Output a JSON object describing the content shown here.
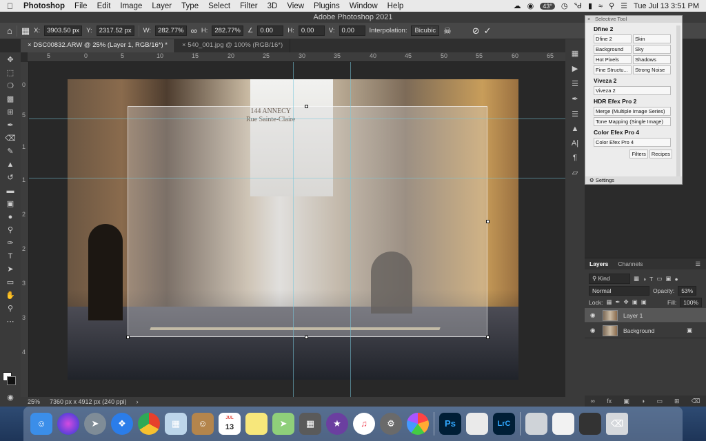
{
  "menubar": {
    "app_name": "Photoshop",
    "items": [
      "File",
      "Edit",
      "Image",
      "Layer",
      "Type",
      "Select",
      "Filter",
      "3D",
      "View",
      "Plugins",
      "Window",
      "Help"
    ],
    "temperature": "43°",
    "datetime": "Tue Jul 13  3:51 PM"
  },
  "window": {
    "title": "Adobe Photoshop 2021"
  },
  "options_bar": {
    "x_label": "X:",
    "x_value": "3903.50 px",
    "y_label": "Y:",
    "y_value": "2317.52 px",
    "w_label": "W:",
    "w_value": "282.77%",
    "h_label": "H:",
    "h_value": "282.77%",
    "angle_value": "0.00",
    "hskew_label": "H:",
    "hskew_value": "0.00",
    "vskew_label": "V:",
    "vskew_value": "0.00",
    "interp_label": "Interpolation:",
    "interp_value": "Bicubic"
  },
  "tabs": [
    {
      "label": "DSC00832.ARW @ 25% (Layer 1, RGB/16*) *"
    },
    {
      "label": "540_001.jpg @ 100% (RGB/16*)"
    }
  ],
  "ruler": {
    "h_ticks": [
      "5",
      "0",
      "5",
      "10",
      "15",
      "20",
      "25",
      "30",
      "35",
      "40",
      "45",
      "50",
      "55",
      "60",
      "65"
    ],
    "v_ticks": [
      "0",
      "5",
      "1",
      "1",
      "2",
      "2",
      "3",
      "3",
      "4"
    ]
  },
  "overlay_text": {
    "line1": "144  ANNECY",
    "line2": "Rue Sainte-Claire"
  },
  "status_bar": {
    "zoom": "25%",
    "doc_info": "7360 px x 4912 px (240 ppi)"
  },
  "selective_tool": {
    "header": "Selective Tool",
    "sections": [
      {
        "title": "Dfine 2",
        "buttons": [
          "Dfine 2",
          "Skin",
          "Background",
          "Sky",
          "Hot Pixels",
          "Shadows",
          "Fine Structu...",
          "Strong Noise"
        ]
      },
      {
        "title": "Viveza 2",
        "buttons": [
          "Viveza 2"
        ]
      },
      {
        "title": "HDR Efex Pro 2",
        "buttons": [
          "Merge (Multiple Image Series)",
          "Tone Mapping (Single Image)"
        ]
      },
      {
        "title": "Color Efex Pro 4",
        "buttons": [
          "Color Efex Pro 4"
        ]
      }
    ],
    "tab_filters": "Filters",
    "tab_recipes": "Recipes",
    "settings": "Settings"
  },
  "layers_panel": {
    "tab_layers": "Layers",
    "tab_channels": "Channels",
    "kind_placeholder": "Kind",
    "blend_mode": "Normal",
    "opacity_label": "Opacity:",
    "opacity_value": "53%",
    "lock_label": "Lock:",
    "fill_label": "Fill:",
    "fill_value": "100%",
    "layers": [
      {
        "name": "Layer 1",
        "selected": true
      },
      {
        "name": "Background",
        "selected": false,
        "locked": true
      }
    ]
  },
  "dock": {
    "apps": [
      "finder-icon",
      "siri-icon",
      "launchpad-icon",
      "safari-icon",
      "chrome-icon",
      "preview-icon",
      "contacts-icon",
      "calendar-icon",
      "notes-icon",
      "maps-icon",
      "calculator-icon",
      "imovie-icon",
      "music-icon",
      "system-preferences-icon",
      "photos-icon"
    ],
    "calendar_day": "13",
    "calendar_month": "JUL",
    "ps_label": "Ps",
    "lrc_label": "LrC"
  }
}
